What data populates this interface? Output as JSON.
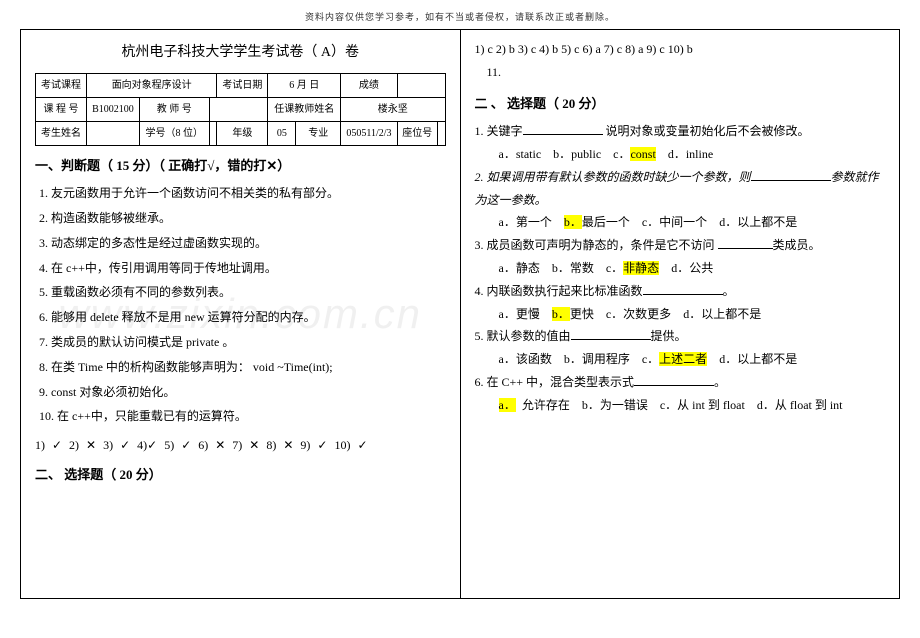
{
  "header_note": "资料内容仅供您学习参考，如有不当或者侵权，请联系改正或者删除。",
  "watermark": "www.zixin.com.cn",
  "left": {
    "title": "杭州电子科技大学学生考试卷（ A）卷",
    "table": {
      "r1c1": "考试课程",
      "r1c2": "面向对象程序设计",
      "r1c3": "考试日期",
      "r1c4": "6 月   日",
      "r1c5": "成绩",
      "r1c6": "",
      "r2c1": "课 程 号",
      "r2c2": "B1002100",
      "r2c3": "教 师 号",
      "r2c4": "",
      "r2c5": "任课教师姓名",
      "r2c6": "楼永坚",
      "r3c1": "考生姓名",
      "r3c2": "",
      "r3c3": "学号（8 位）",
      "r3c4": "",
      "r3c5": "年级",
      "r3c6": "05",
      "r3c7": "专业",
      "r3c8": "050511/2/3",
      "r3c9": "座位号",
      "r3c10": ""
    },
    "sec1_h": "一、判断题（ 15 分）（ 正确打√，错的打✕）",
    "q1": "1.  友元函数用于允许一个函数访问不相关类的私有部分。",
    "q2": "2.  构造函数能够被继承。",
    "q3": "3.  动态绑定的多态性是经过虚函数实现的。",
    "q4": "4.  在 c++中，传引用调用等同于传地址调用。",
    "q5": "5.  重载函数必须有不同的参数列表。",
    "q6": "6.  能够用 delete 释放不是用 new 运算符分配的内存。",
    "q7": "7.  类成员的默认访问模式是 private 。",
    "q8": "8.  在类 Time 中的析构函数能够声明为： void  ~Time(int);",
    "q9": "9.  const 对象必须初始化。",
    "q10": "10. 在 c++中，只能重载已有的运算符。",
    "ans": "1) ✓   2) ✕  3) ✓  4)✓  5) ✓  6) ✕  7) ✕  8) ✕  9) ✓  10) ✓",
    "sec2_h": "二、 选择题（ 20 分）"
  },
  "right": {
    "top_ans": "1)  c  2) b   3)  c  4)  b   5) c   6)  a  7) c   8) a   9) c  10) b",
    "top_ans2": "11.",
    "sec2_h": "二 、 选择题（ 20 分）",
    "q1": "1.  关键字",
    "q1b": "说明对象或变量初始化后不会被修改。",
    "q1o_a": "a．static",
    "q1o_b": "b．public",
    "q1o_c": "c．",
    "q1o_c2": "const",
    "q1o_d": "d．inline",
    "q2a": "2. 如果调用带有默认参数的函数时缺少一个参数，则",
    "q2b": "参数就作为这一参数。",
    "q2o_a": "a．第一个",
    "q2o_b": "b．",
    "q2o_b2": "最后一个",
    "q2o_c": "c．中间一个",
    "q2o_d": "d．以上都不是",
    "q3a": "3.  成员函数可声明为静态的，条件是它不访问",
    "q3b": "类成员。",
    "q3o_a": "a．静态",
    "q3o_b": "b．常数",
    "q3o_c": "c．",
    "q3o_c2": "非静态",
    "q3o_d": "d．公共",
    "q4": "4.  内联函数执行起来比标准函数",
    "q4o_a": "a．更慢",
    "q4o_b": "b．",
    "q4o_b2": "更快",
    "q4o_c": "c．次数更多",
    "q4o_d": "d．以上都不是",
    "q5a": "5.  默认参数的值由",
    "q5b": "提供。",
    "q5o_a": "a．该函数",
    "q5o_b": "b．调用程序",
    "q5o_c": "c．",
    "q5o_c2": "上述二者",
    "q5o_d": "d．以上都不是",
    "q6": "6.  在 C++ 中，混合类型表示式",
    "q6b": "。",
    "q6o_a": "a．",
    "q6o_a2": "允许存在",
    "q6o_b": "b．为一错误",
    "q6o_c": "c．从 int 到 float",
    "q6o_d": "d．从 float 到 int"
  }
}
